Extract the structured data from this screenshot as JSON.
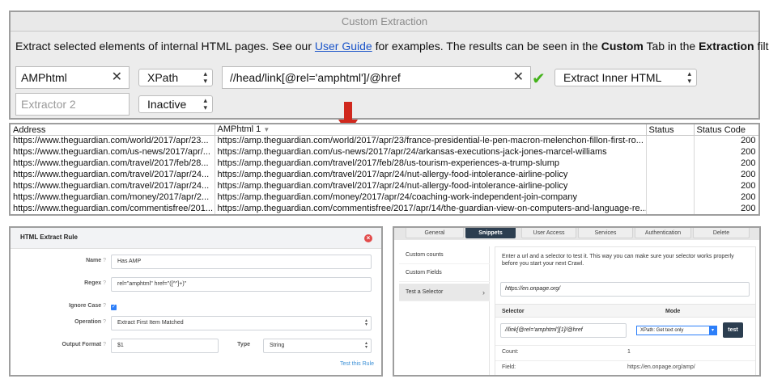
{
  "extraction": {
    "title": "Custom Extraction",
    "desc_pre": "Extract selected elements of internal HTML pages. See our ",
    "desc_link": "User Guide",
    "desc_mid": " for examples. The results can be seen in the ",
    "desc_bold1": "Custom",
    "desc_mid2": " Tab in the ",
    "desc_bold2": "Extraction",
    "desc_post": " filter.",
    "row1": {
      "name": "AMPhtml",
      "type": "XPath",
      "expr": "//head/link[@rel='amphtml']/@href",
      "mode": "Extract Inner HTML"
    },
    "row2": {
      "name_placeholder": "Extractor 2",
      "type": "Inactive"
    }
  },
  "table": {
    "headers": [
      "Address",
      "AMPhtml 1",
      "Status",
      "Status Code"
    ],
    "rows": [
      [
        "https://www.theguardian.com/world/2017/apr/23...",
        "https://amp.theguardian.com/world/2017/apr/23/france-presidential-le-pen-macron-melenchon-fillon-first-ro...",
        "",
        "200"
      ],
      [
        "https://www.theguardian.com/us-news/2017/apr/...",
        "https://amp.theguardian.com/us-news/2017/apr/24/arkansas-executions-jack-jones-marcel-williams",
        "",
        "200"
      ],
      [
        "https://www.theguardian.com/travel/2017/feb/28...",
        "https://amp.theguardian.com/travel/2017/feb/28/us-tourism-experiences-a-trump-slump",
        "",
        "200"
      ],
      [
        "https://www.theguardian.com/travel/2017/apr/24...",
        "https://amp.theguardian.com/travel/2017/apr/24/nut-allergy-food-intolerance-airline-policy",
        "",
        "200"
      ],
      [
        "https://www.theguardian.com/travel/2017/apr/24...",
        "https://amp.theguardian.com/travel/2017/apr/24/nut-allergy-food-intolerance-airline-policy",
        "",
        "200"
      ],
      [
        "https://www.theguardian.com/money/2017/apr/2...",
        "https://amp.theguardian.com/money/2017/apr/24/coaching-work-independent-join-company",
        "",
        "200"
      ],
      [
        "https://www.theguardian.com/commentisfree/201...",
        "https://amp.theguardian.com/commentisfree/2017/apr/14/the-guardian-view-on-computers-and-language-re...",
        "",
        "200"
      ]
    ]
  },
  "rule": {
    "title": "HTML Extract Rule",
    "name_label": "Name",
    "name_value": "Has AMP",
    "regex_label": "Regex",
    "regex_value": "rel=\"amphtml\" href=\"([^\"]+)\"",
    "ignore_case_label": "Ignore Case",
    "operation_label": "Operation",
    "operation_value": "Extract First Item Matched",
    "output_label": "Output Format",
    "output_value": "$1",
    "type_label": "Type",
    "type_value": "String",
    "test_link": "Test this Rule"
  },
  "snippets": {
    "tabs": [
      "General",
      "Snippets",
      "User Access",
      "Services",
      "Authentication",
      "Delete"
    ],
    "active_tab": "Snippets",
    "side": [
      "Custom counts",
      "Custom Fields",
      "Test a Selector"
    ],
    "intro": "Enter a url and a selector to test it. This way you can make sure your selector works properly before you start your next Crawl.",
    "url_value": "https://en.onpage.org/",
    "selector_header": "Selector",
    "mode_header": "Mode",
    "selector_value": "//link[@rel='amphtml'][1]/@href",
    "mode_value": "XPath: Get text only",
    "test_button": "test",
    "count_label": "Count:",
    "count_value": "1",
    "field_label": "Field:",
    "field_value": "https://en.onpage.org/amp/"
  }
}
